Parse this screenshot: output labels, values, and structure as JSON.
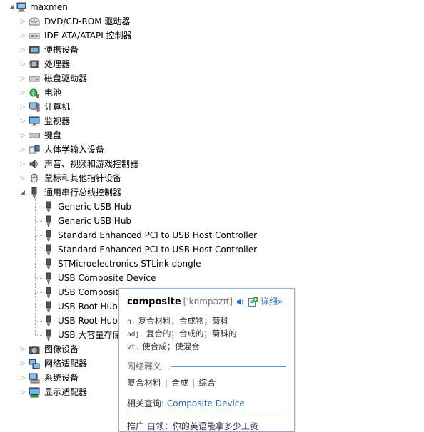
{
  "tree": {
    "root": {
      "label": "maxmen",
      "icon": "computer-icon"
    },
    "categories": [
      {
        "label": "DVD/CD-ROM 驱动器",
        "icon": "dvd-drive-icon"
      },
      {
        "label": "IDE ATA/ATAPI 控制器",
        "icon": "ide-controller-icon"
      },
      {
        "label": "便携设备",
        "icon": "portable-device-icon"
      },
      {
        "label": "处理器",
        "icon": "processor-icon"
      },
      {
        "label": "磁盘驱动器",
        "icon": "disk-drive-icon"
      },
      {
        "label": "电池",
        "icon": "battery-icon"
      },
      {
        "label": "计算机",
        "icon": "computer-monitor-icon"
      },
      {
        "label": "监视器",
        "icon": "monitor-icon"
      },
      {
        "label": "键盘",
        "icon": "keyboard-icon"
      },
      {
        "label": "人体学输入设备",
        "icon": "hid-icon"
      },
      {
        "label": "声音、视频和游戏控制器",
        "icon": "speaker-icon"
      },
      {
        "label": "鼠标和其他指针设备",
        "icon": "mouse-icon"
      },
      {
        "label": "通用串行总线控制器",
        "icon": "usb-plug-icon",
        "expanded": true
      }
    ],
    "usb_children": [
      "Generic USB Hub",
      "Generic USB Hub",
      "Standard Enhanced PCI to USB Host Controller",
      "Standard Enhanced PCI to USB Host Controller",
      "STMicroelectronics STLink dongle",
      "USB Composite Device",
      "USB Composite Device",
      "USB Root Hub",
      "USB Root Hub",
      "USB 大容量存储设备"
    ],
    "after_categories": [
      {
        "label": "图像设备",
        "icon": "camera-icon"
      },
      {
        "label": "网络适配器",
        "icon": "network-adapter-icon"
      },
      {
        "label": "系统设备",
        "icon": "system-device-icon"
      },
      {
        "label": "显示适配器",
        "icon": "display-adapter-icon"
      }
    ]
  },
  "dictionary_popup": {
    "word": "composite",
    "phonetic": "['kɒmpəzɪt]",
    "detail_label": "详细»",
    "definitions": [
      {
        "pos": "n.",
        "text": "复合材料；合成物；菊科"
      },
      {
        "pos": "adj.",
        "text": "复合的；合成的；菊科的"
      },
      {
        "pos": "vt.",
        "text": "使合成；使混合"
      }
    ],
    "web_section_title": "网络释义",
    "web_terms": [
      "复合材料",
      "合成",
      "综合"
    ],
    "related_label": "相关查询:",
    "related_link": "Composite Device",
    "promo_text": "推广 白领：你的英语能拿多少工资"
  },
  "colors": {
    "link": "#2a6ebd",
    "rule": "#5e9bd3",
    "popup_border": "#8fb3d9"
  }
}
